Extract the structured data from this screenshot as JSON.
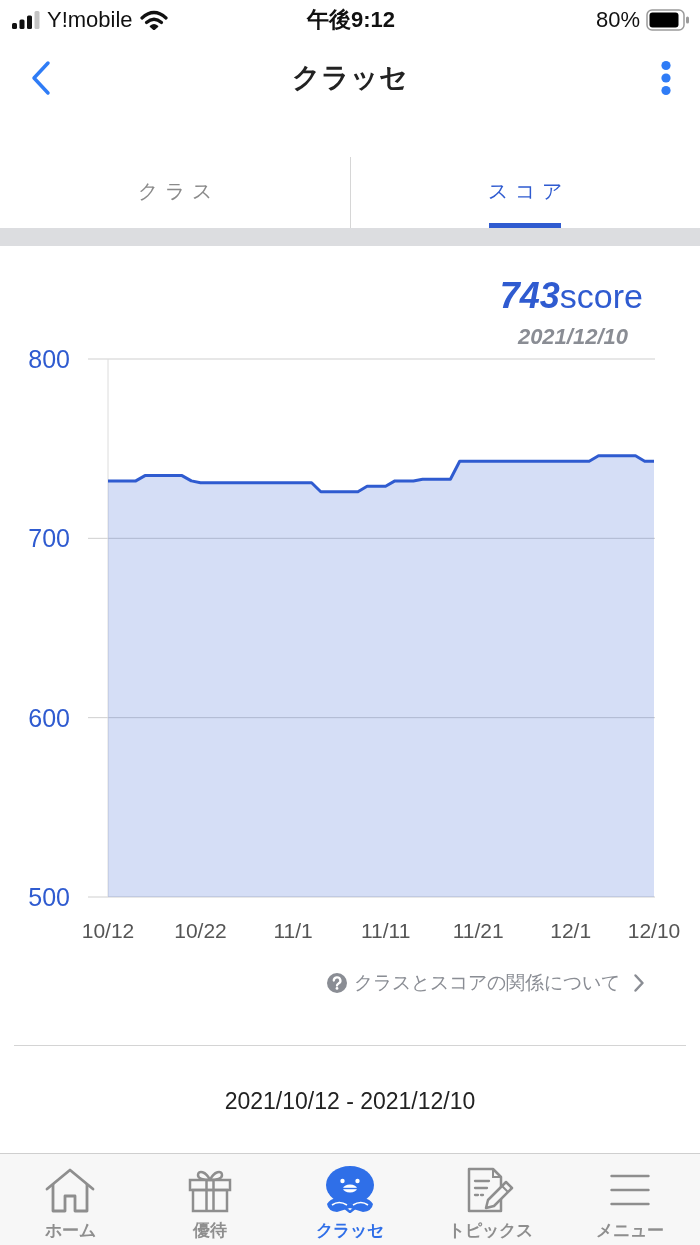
{
  "status_bar": {
    "carrier": "Y!mobile",
    "time": "午後9:12",
    "battery": "80%"
  },
  "nav_bar": {
    "title": "クラッセ"
  },
  "tabs": [
    {
      "label": "クラス",
      "selected": false
    },
    {
      "label": "スコア",
      "selected": true
    }
  ],
  "score": {
    "value": "743",
    "unit": "score",
    "date": "2021/12/10"
  },
  "chart": {
    "chart_data": {
      "type": "area",
      "categories": [
        "10/12",
        null,
        null,
        null,
        null,
        null,
        null,
        null,
        null,
        null,
        "10/22",
        null,
        null,
        null,
        null,
        null,
        null,
        null,
        null,
        null,
        "11/1",
        null,
        null,
        null,
        null,
        null,
        null,
        null,
        null,
        null,
        "11/11",
        null,
        null,
        null,
        null,
        null,
        null,
        null,
        null,
        null,
        "11/21",
        null,
        null,
        null,
        null,
        null,
        null,
        null,
        null,
        null,
        "12/1",
        null,
        null,
        null,
        null,
        null,
        null,
        null,
        null,
        "12/10"
      ],
      "series": [
        {
          "color": "#2f5bd0",
          "values": [
            732,
            732,
            732,
            732,
            735,
            735,
            735,
            735,
            735,
            732,
            731,
            731,
            731,
            731,
            731,
            731,
            731,
            731,
            731,
            731,
            731,
            731,
            731,
            726,
            726,
            726,
            726,
            726,
            729,
            729,
            729,
            732,
            732,
            732,
            733,
            733,
            733,
            733,
            743,
            743,
            743,
            743,
            743,
            743,
            743,
            743,
            743,
            743,
            743,
            743,
            743,
            743,
            743,
            746,
            746,
            746,
            746,
            746,
            743,
            743
          ]
        }
      ],
      "ylim": [
        500,
        800
      ],
      "yticks": [
        500,
        600,
        700,
        800
      ]
    }
  },
  "help_link": {
    "label": "クラスとスコアの関係について"
  },
  "period": "2021/10/12 - 2021/12/10",
  "tab_bar": [
    {
      "kind": "home",
      "label": "ホーム",
      "selected": false
    },
    {
      "kind": "gift",
      "label": "優待",
      "selected": false
    },
    {
      "kind": "mascot",
      "label": "クラッセ",
      "selected": true
    },
    {
      "kind": "topics",
      "label": "トピックス",
      "selected": false
    },
    {
      "kind": "menu",
      "label": "メニュー",
      "selected": false
    }
  ]
}
